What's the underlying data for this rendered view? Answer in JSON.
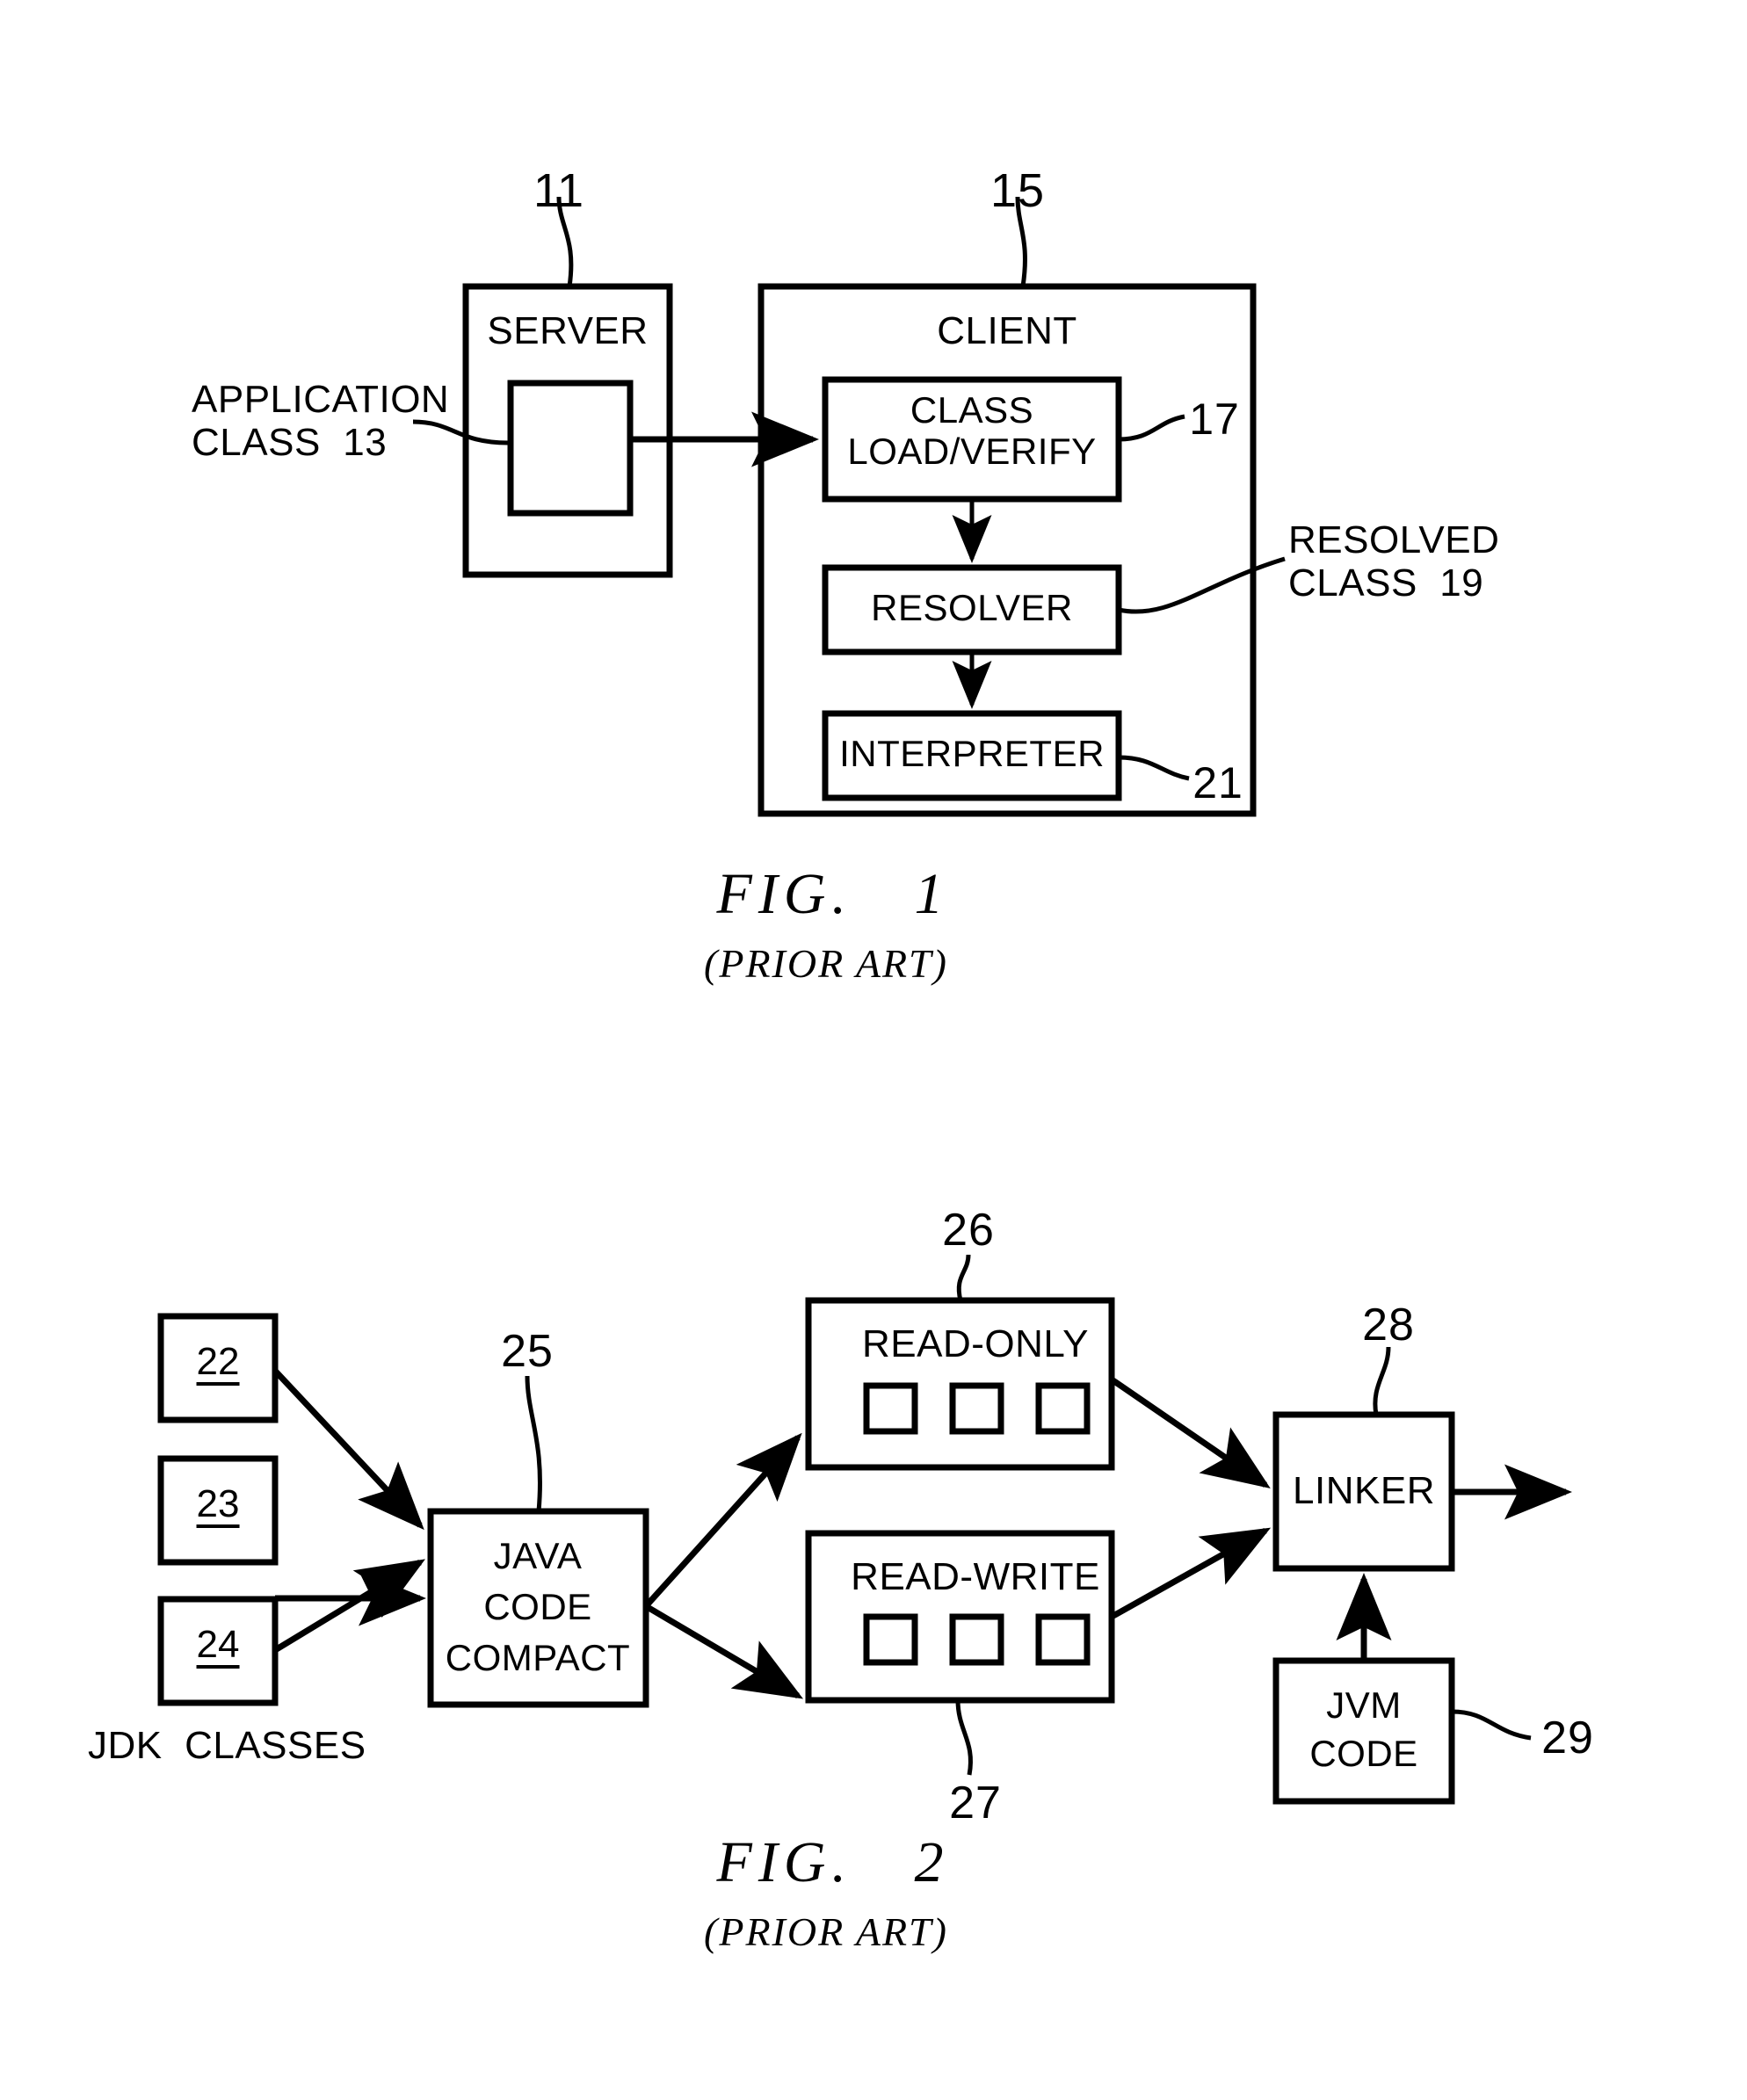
{
  "sheet": {
    "background": "#ffffff",
    "ink": "#000000"
  },
  "figure1": {
    "caption_title": "FIG.   1",
    "caption_subtitle": "(PRIOR ART)",
    "server_box": {
      "label": "SERVER",
      "ref": "11"
    },
    "client_box": {
      "label": "CLIENT",
      "ref": "15"
    },
    "application_class_label": "APPLICATION\nCLASS  13",
    "resolved_class_label": "RESOLVED\nCLASS  19",
    "blocks": [
      {
        "label": "CLASS\nLOAD/VERIFY",
        "ref": "17"
      },
      {
        "label": "RESOLVER",
        "ref": ""
      },
      {
        "label": "INTERPRETER",
        "ref": "21"
      }
    ]
  },
  "figure2": {
    "caption_title": "FIG.   2",
    "caption_subtitle": "(PRIOR ART)",
    "jdk_classes_label": "JDK  CLASSES",
    "jdk_class_boxes": [
      {
        "number": "22"
      },
      {
        "number": "23"
      },
      {
        "number": "24"
      }
    ],
    "compactor": {
      "label": "JAVA\nCODE\nCOMPACT",
      "ref": "25"
    },
    "segments": [
      {
        "label": "READ-ONLY",
        "ref": "26",
        "slots": 3
      },
      {
        "label": "READ-WRITE",
        "ref": "27",
        "slots": 3
      }
    ],
    "linker": {
      "label": "LINKER",
      "ref": "28"
    },
    "jvm_code": {
      "label": "JVM\nCODE",
      "ref": "29"
    }
  }
}
